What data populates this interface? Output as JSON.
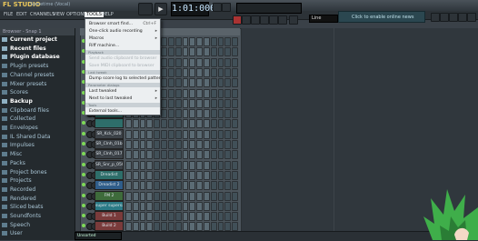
{
  "app": {
    "logo": "FL STUDIO",
    "song_title": "Sometime (Vocal)"
  },
  "menubar": {
    "items": [
      {
        "label": "FILE"
      },
      {
        "label": "EDIT"
      },
      {
        "label": "CHANNELS"
      },
      {
        "label": "VIEW"
      },
      {
        "label": "OPTIONS"
      },
      {
        "label": "TOOLS"
      },
      {
        "label": "HELP"
      }
    ]
  },
  "transport": {
    "time": "1:01:000",
    "pattern": "Line"
  },
  "news": {
    "text": "Click to enable online news"
  },
  "browser": {
    "header": "Browser - Snap 1",
    "items": [
      {
        "label": "Current project",
        "hl": true
      },
      {
        "label": "Recent files",
        "hl": true
      },
      {
        "label": "Plugin database",
        "hl": true
      },
      {
        "label": "Plugin presets"
      },
      {
        "label": "Channel presets"
      },
      {
        "label": "Mixer presets"
      },
      {
        "label": "Scores"
      },
      {
        "label": "Backup",
        "hl": true
      },
      {
        "label": "Clipboard files"
      },
      {
        "label": "Collected"
      },
      {
        "label": "Envelopes"
      },
      {
        "label": "IL Shared Data"
      },
      {
        "label": "Impulses"
      },
      {
        "label": "Misc"
      },
      {
        "label": "Packs"
      },
      {
        "label": "Project bones"
      },
      {
        "label": "Projects"
      },
      {
        "label": "Recorded"
      },
      {
        "label": "Rendered"
      },
      {
        "label": "Sliced beats"
      },
      {
        "label": "Soundfonts"
      },
      {
        "label": "Speech"
      },
      {
        "label": "User"
      }
    ]
  },
  "tools_menu": {
    "items": [
      {
        "label": "Browser smart find...",
        "shortcut": "Ctrl+F"
      },
      {
        "label": "One-click audio recording",
        "submenu": true
      },
      {
        "label": "Macros",
        "submenu": true
      },
      {
        "label": "Riff machine..."
      },
      {
        "section": "Playback"
      },
      {
        "label": "Send audio clipboard to browser",
        "disabled": true
      },
      {
        "label": "Save MIDI clipboard to browser",
        "disabled": true
      },
      {
        "section": "Last tweak"
      },
      {
        "label": "Dump score log to selected pattern"
      },
      {
        "section": "Parameter dialogs"
      },
      {
        "label": "Last tweaked",
        "submenu": true
      },
      {
        "label": "Next to last tweaked",
        "submenu": true
      },
      {
        "section": "Tools"
      },
      {
        "label": "External tools..."
      }
    ]
  },
  "channels": [
    {
      "name": "",
      "color": "teal"
    },
    {
      "name": "",
      "color": "teal"
    },
    {
      "name": "",
      "color": "teal"
    },
    {
      "name": "",
      "color": "teal"
    },
    {
      "name": "",
      "color": "teal"
    },
    {
      "name": "",
      "color": "teal"
    },
    {
      "name": "",
      "color": "teal"
    },
    {
      "name": "",
      "color": "teal"
    },
    {
      "name": "",
      "color": "teal"
    },
    {
      "name": "SR_Kck_020",
      "color": "gray"
    },
    {
      "name": "SR_Clnh_01b",
      "color": "gray"
    },
    {
      "name": "SR_Clnh_017",
      "color": "gray"
    },
    {
      "name": "SR_Snr_p_050",
      "color": "gray"
    },
    {
      "name": "Dreadist",
      "color": "teal"
    },
    {
      "name": "Dreadist 2",
      "color": "blue"
    },
    {
      "name": "FM 2",
      "color": "green"
    },
    {
      "name": "super supersaw",
      "color": "cyan"
    },
    {
      "name": "Build 1",
      "color": "red"
    },
    {
      "name": "Build 2",
      "color": "red"
    }
  ],
  "status": {
    "text": "Unsorted"
  },
  "colors": {
    "accent": "#e8c65a",
    "bg": "#3a4148",
    "menu_bg": "#eceff1"
  }
}
